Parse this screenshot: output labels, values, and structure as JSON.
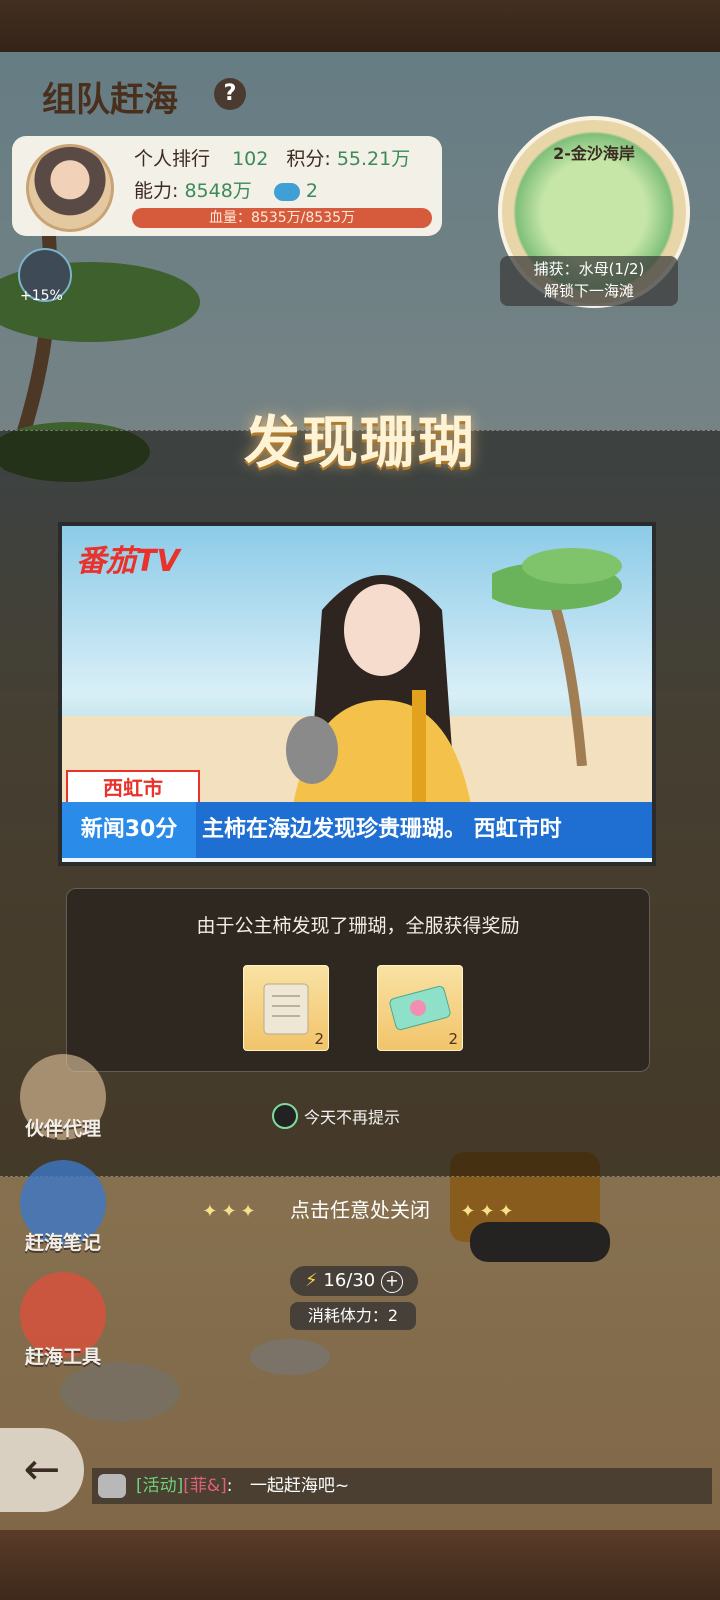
{
  "header": {
    "title": "组队赶海",
    "help_icon": "?"
  },
  "player": {
    "rank_label": "个人排行",
    "rank_value": "102",
    "score_label": "积分:",
    "score_value": "55.21万",
    "power_label": "能力:",
    "power_value": "8548万",
    "wave_count": "2",
    "hp_text": "血量：8535万/8535万"
  },
  "buff": {
    "value": "+15%"
  },
  "map": {
    "name": "2-金沙海岸",
    "catch_text": "捕获：水母(1/2)",
    "unlock_text": "解锁下一海滩"
  },
  "banner": {
    "title": "发现珊瑚"
  },
  "tv": {
    "brand": "番茄TV",
    "city": "西虹市",
    "ticker_label": "新闻30分",
    "ticker_text": "主柿在海边发现珍贵珊瑚。   西虹市时"
  },
  "reward": {
    "text": "由于公主柿发现了珊瑚，全服获得奖励",
    "items": [
      {
        "icon": "scroll-icon",
        "count": "2"
      },
      {
        "icon": "ticket-icon",
        "count": "2"
      }
    ]
  },
  "dont_show": {
    "label": "今天不再提示"
  },
  "close_hint": "点击任意处关闭",
  "side_menu": [
    {
      "label": "伙伴代理"
    },
    {
      "label": "赶海笔记"
    },
    {
      "label": "赶海工具"
    }
  ],
  "stamina": {
    "value": "16/30",
    "cost": "消耗体力：2"
  },
  "chat": {
    "tag": "[活动]",
    "name": "[菲&]",
    "colon": ":",
    "message": "一起赶海吧~"
  },
  "colors": {
    "accent_red": "#e8322b",
    "tv_blue": "#1e6fd1",
    "green_value": "#3c8a5a"
  }
}
